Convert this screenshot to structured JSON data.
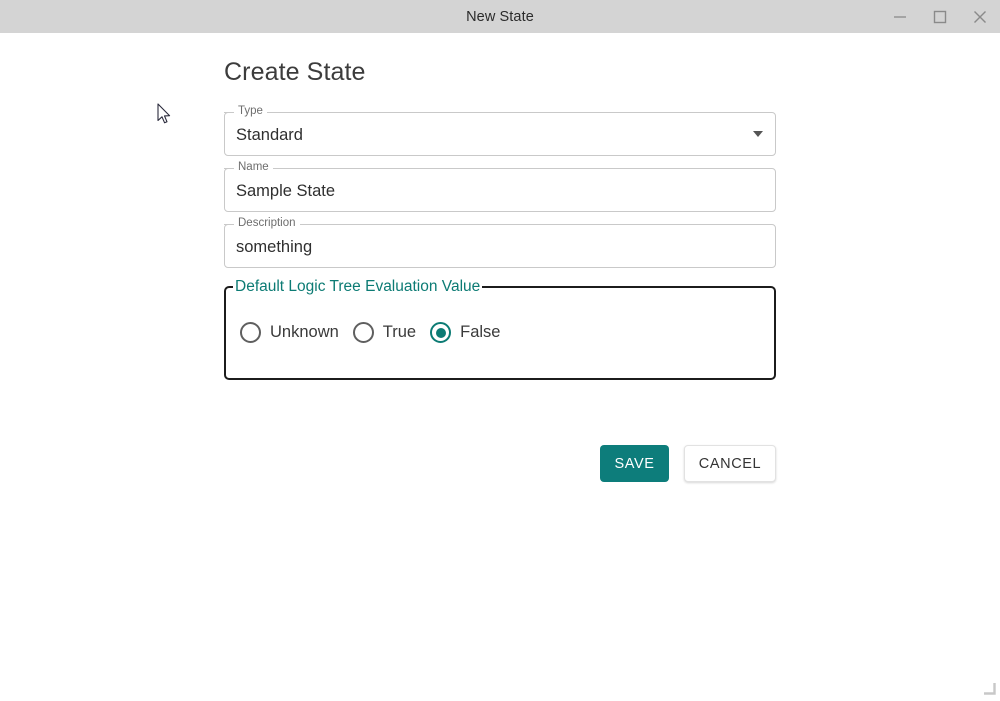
{
  "window": {
    "title": "New State",
    "controls": [
      {
        "name": "minimize",
        "icon": "minimize-icon"
      },
      {
        "name": "maximize",
        "icon": "maximize-icon"
      },
      {
        "name": "close",
        "icon": "close-icon"
      }
    ]
  },
  "page": {
    "heading": "Create State"
  },
  "form": {
    "type_field": {
      "label": "Type",
      "value": "Standard",
      "control": "select",
      "caret_icon": "chevron-down-icon"
    },
    "name_field": {
      "label": "Name",
      "value": "Sample State",
      "placeholder": ""
    },
    "description_field": {
      "label": "Description",
      "value": "something",
      "placeholder": ""
    },
    "radio_group": {
      "legend": "Default Logic Tree Evaluation Value",
      "options": [
        {
          "label": "Unknown",
          "selected": false
        },
        {
          "label": "True",
          "selected": false
        },
        {
          "label": "False",
          "selected": true
        }
      ],
      "selected_value": "False"
    }
  },
  "actions": {
    "save_label": "SAVE",
    "cancel_label": "CANCEL"
  },
  "colors": {
    "accent_teal": "#0d7d7b",
    "legend_teal": "#0c7b74",
    "titlebar": "#d4d4d4",
    "field_border": "#c9c9c9",
    "fieldset_border": "#1c1c1c"
  }
}
